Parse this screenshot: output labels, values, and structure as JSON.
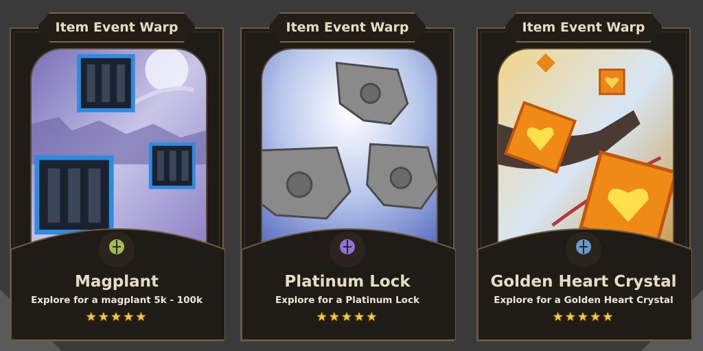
{
  "cards": [
    {
      "header": "Item Event Warp",
      "title": "Magplant",
      "description": "Explore for a magplant 5k - 100k",
      "stars": "★★★★★",
      "rarity": 5,
      "emblem_color": "#b9d65a",
      "art_icon": "magplant-icon"
    },
    {
      "header": "Item Event Warp",
      "title": "Platinum Lock",
      "description": "Explore for a Platinum Lock",
      "stars": "★★★★★",
      "rarity": 5,
      "emblem_color": "#9a7cf0",
      "art_icon": "platinum-lock-icon"
    },
    {
      "header": "Item Event Warp",
      "title": "Golden Heart Crystal",
      "description": "Explore for a Golden Heart Crystal",
      "stars": "★★★★★",
      "rarity": 5,
      "emblem_color": "#6fa6e8",
      "art_icon": "golden-heart-crystal-icon"
    }
  ],
  "colors": {
    "card_bg": "#1f1b16",
    "border": "#6b5a3e",
    "star": "#f2c64a",
    "text": "#e7ddc5"
  }
}
